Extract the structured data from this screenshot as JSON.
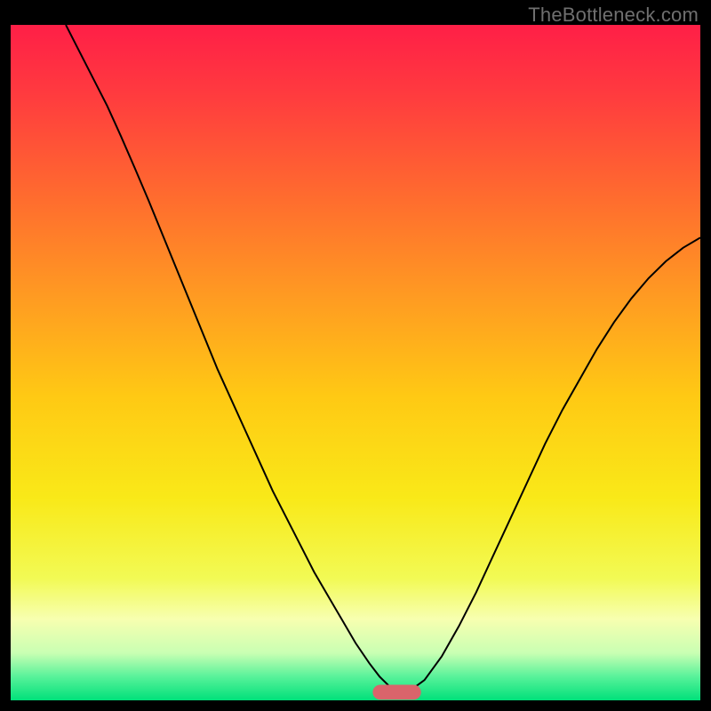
{
  "watermark": "TheBottleneck.com",
  "chart_data": {
    "type": "line",
    "title": "",
    "xlabel": "",
    "ylabel": "",
    "xlim": [
      0,
      100
    ],
    "ylim": [
      0,
      100
    ],
    "grid": false,
    "legend": false,
    "background_gradient": {
      "stops": [
        {
          "offset": 0.0,
          "color": "#ff1f47"
        },
        {
          "offset": 0.1,
          "color": "#ff3a3f"
        },
        {
          "offset": 0.25,
          "color": "#ff6a2f"
        },
        {
          "offset": 0.4,
          "color": "#ff9a22"
        },
        {
          "offset": 0.55,
          "color": "#ffc914"
        },
        {
          "offset": 0.7,
          "color": "#f9e918"
        },
        {
          "offset": 0.82,
          "color": "#f2fa55"
        },
        {
          "offset": 0.88,
          "color": "#f7ffb0"
        },
        {
          "offset": 0.93,
          "color": "#c9ffb3"
        },
        {
          "offset": 0.965,
          "color": "#58f29a"
        },
        {
          "offset": 1.0,
          "color": "#00e07a"
        }
      ]
    },
    "marker": {
      "x": 56,
      "y": 1.2,
      "width": 7,
      "height": 2.2,
      "color": "#d9646b",
      "rx": 1.1
    },
    "series": [
      {
        "name": "curve",
        "color": "#000000",
        "stroke_width": 2,
        "x": [
          8.0,
          10.0,
          12.0,
          14.0,
          16.0,
          18.0,
          20.0,
          22.0,
          24.0,
          26.0,
          28.0,
          30.0,
          32.0,
          34.0,
          36.0,
          38.0,
          40.0,
          42.0,
          44.0,
          46.0,
          48.0,
          50.0,
          52.0,
          53.5,
          55.0,
          56.5,
          58.0,
          60.0,
          62.5,
          65.0,
          67.5,
          70.0,
          72.5,
          75.0,
          77.5,
          80.0,
          82.5,
          85.0,
          87.5,
          90.0,
          92.5,
          95.0,
          97.5,
          100.0
        ],
        "values": [
          100.0,
          96.0,
          92.0,
          88.0,
          83.5,
          78.8,
          74.0,
          69.0,
          64.0,
          59.0,
          54.0,
          49.0,
          44.5,
          40.0,
          35.5,
          31.0,
          27.0,
          23.0,
          19.0,
          15.5,
          12.0,
          8.5,
          5.5,
          3.5,
          2.0,
          1.2,
          1.5,
          3.0,
          6.5,
          11.0,
          16.0,
          21.5,
          27.0,
          32.5,
          38.0,
          43.0,
          47.5,
          52.0,
          56.0,
          59.5,
          62.5,
          65.0,
          67.0,
          68.5
        ]
      }
    ]
  }
}
